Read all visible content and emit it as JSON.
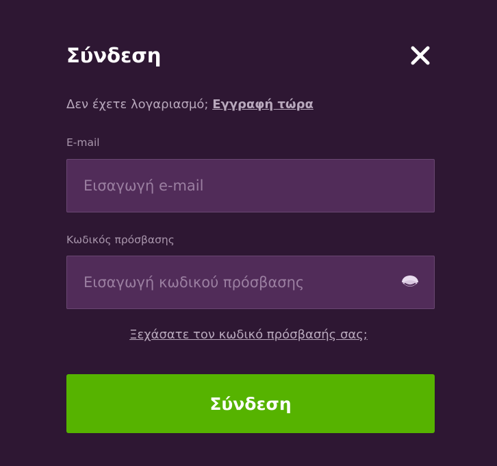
{
  "modal": {
    "title": "Σύνδεση",
    "close_icon": "close-icon"
  },
  "signup": {
    "prompt": "Δεν έχετε λογαριασμό;",
    "link_label": "Εγγραφή τώρα"
  },
  "email": {
    "label": "E-mail",
    "placeholder": "Εισαγωγή e-mail",
    "value": ""
  },
  "password": {
    "label": "Κωδικός πρόσβασης",
    "placeholder": "Εισαγωγή κωδικού πρόσβασης",
    "value": "",
    "toggle_icon": "eye-icon"
  },
  "forgot_link": "Ξεχάσατε τον κωδικό πρόσβασής σας;",
  "submit_label": "Σύνδεση",
  "colors": {
    "background": "#2e1733",
    "input_bg": "#512c59",
    "accent_button": "#56b300",
    "muted_text": "#b9a9bd"
  }
}
